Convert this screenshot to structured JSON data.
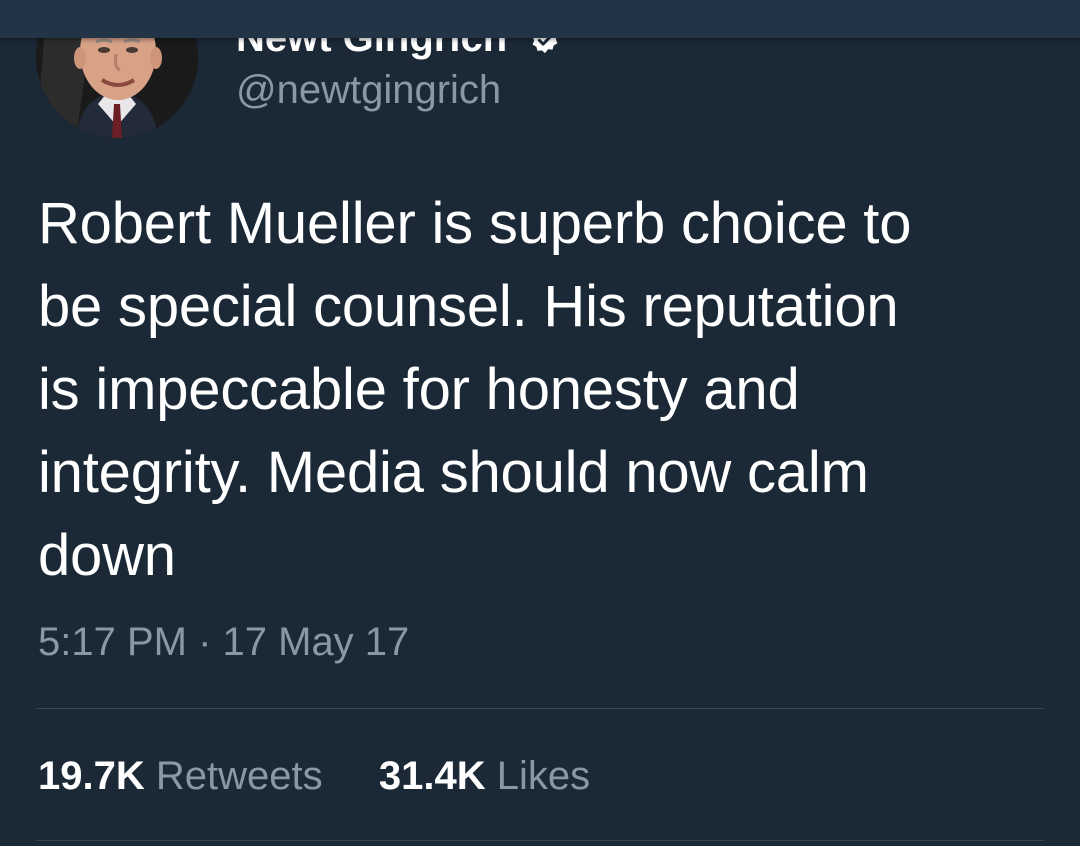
{
  "tweet": {
    "display_name": "Newt Gingrich",
    "handle": "@newtgingrich",
    "text_lines": [
      "Robert Mueller is superb choice to",
      "be special counsel. His reputation",
      "is impeccable for honesty and",
      "integrity. Media should now calm",
      "down"
    ],
    "timestamp": "5:17 PM · 17 May 17",
    "retweets_count": "19.7K",
    "retweets_label": "Retweets",
    "likes_count": "31.4K",
    "likes_label": "Likes"
  },
  "icons": {
    "verified": "verified-badge-icon",
    "avatar": "profile-avatar"
  },
  "colors": {
    "background": "#1b2836",
    "header": "#243447",
    "text_primary": "#ffffff",
    "text_secondary": "#8899a6",
    "divider": "#38444d"
  }
}
